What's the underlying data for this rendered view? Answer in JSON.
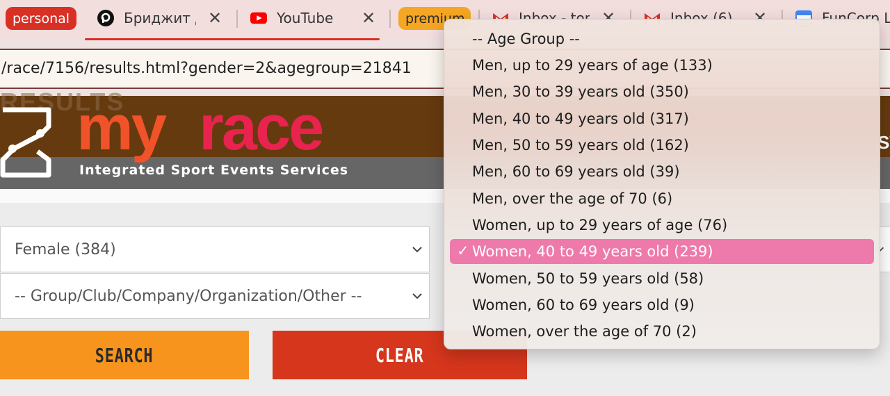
{
  "browser": {
    "tabs": [
      {
        "kind": "group",
        "label": "personal",
        "color": "#d93025"
      },
      {
        "kind": "tab",
        "label": "Бриджит Д",
        "icon": "circle-p-icon",
        "active": true
      },
      {
        "kind": "tab",
        "label": "YouTube",
        "icon": "youtube-icon"
      },
      {
        "kind": "group",
        "label": "premium",
        "color": "#f5a623"
      },
      {
        "kind": "tab",
        "label": "Inbox - ton",
        "icon": "gmail-icon"
      },
      {
        "kind": "tab",
        "label": "Inbox (6)",
        "icon": "gmail-icon"
      },
      {
        "kind": "tab",
        "label": "FunCorp L",
        "icon": "calendar-icon"
      }
    ],
    "url": "/race/7156/results.html?gender=2&agegroup=21841"
  },
  "banner": {
    "ghost_text": "RESULTS",
    "brand_part1": "my",
    "brand_part2": "race",
    "tagline": "Integrated Sport Events Services",
    "right_fragment": "ST"
  },
  "filters": {
    "gender_value": "Female (384)",
    "group_value": "-- Group/Club/Company/Organization/Other --"
  },
  "buttons": {
    "search": "SEARCH",
    "clear": "CLEAR"
  },
  "age_group_menu": {
    "items": [
      "-- Age Group --",
      "Men, up to 29 years of age (133)",
      "Men, 30 to 39 years old (350)",
      "Men, 40 to 49 years old (317)",
      "Men, 50 to 59 years old (162)",
      "Men, 60 to 69 years old (39)",
      "Men, over the age of 70 (6)",
      "Women, up to 29 years of age (76)",
      "Women, 40 to 49 years old (239)",
      "Women, 50 to 59 years old (58)",
      "Women, 60 to 69 years old (9)",
      "Women, over the age of 70 (2)"
    ],
    "selected_index": 8,
    "selected_mark": "✓"
  },
  "colors": {
    "brand_orange": "#f0522a",
    "brand_red": "#e8234e",
    "banner_brown": "#663a0f",
    "search_button": "#f7941d",
    "clear_button": "#d6361c",
    "menu_selected": "#ee7aab"
  }
}
